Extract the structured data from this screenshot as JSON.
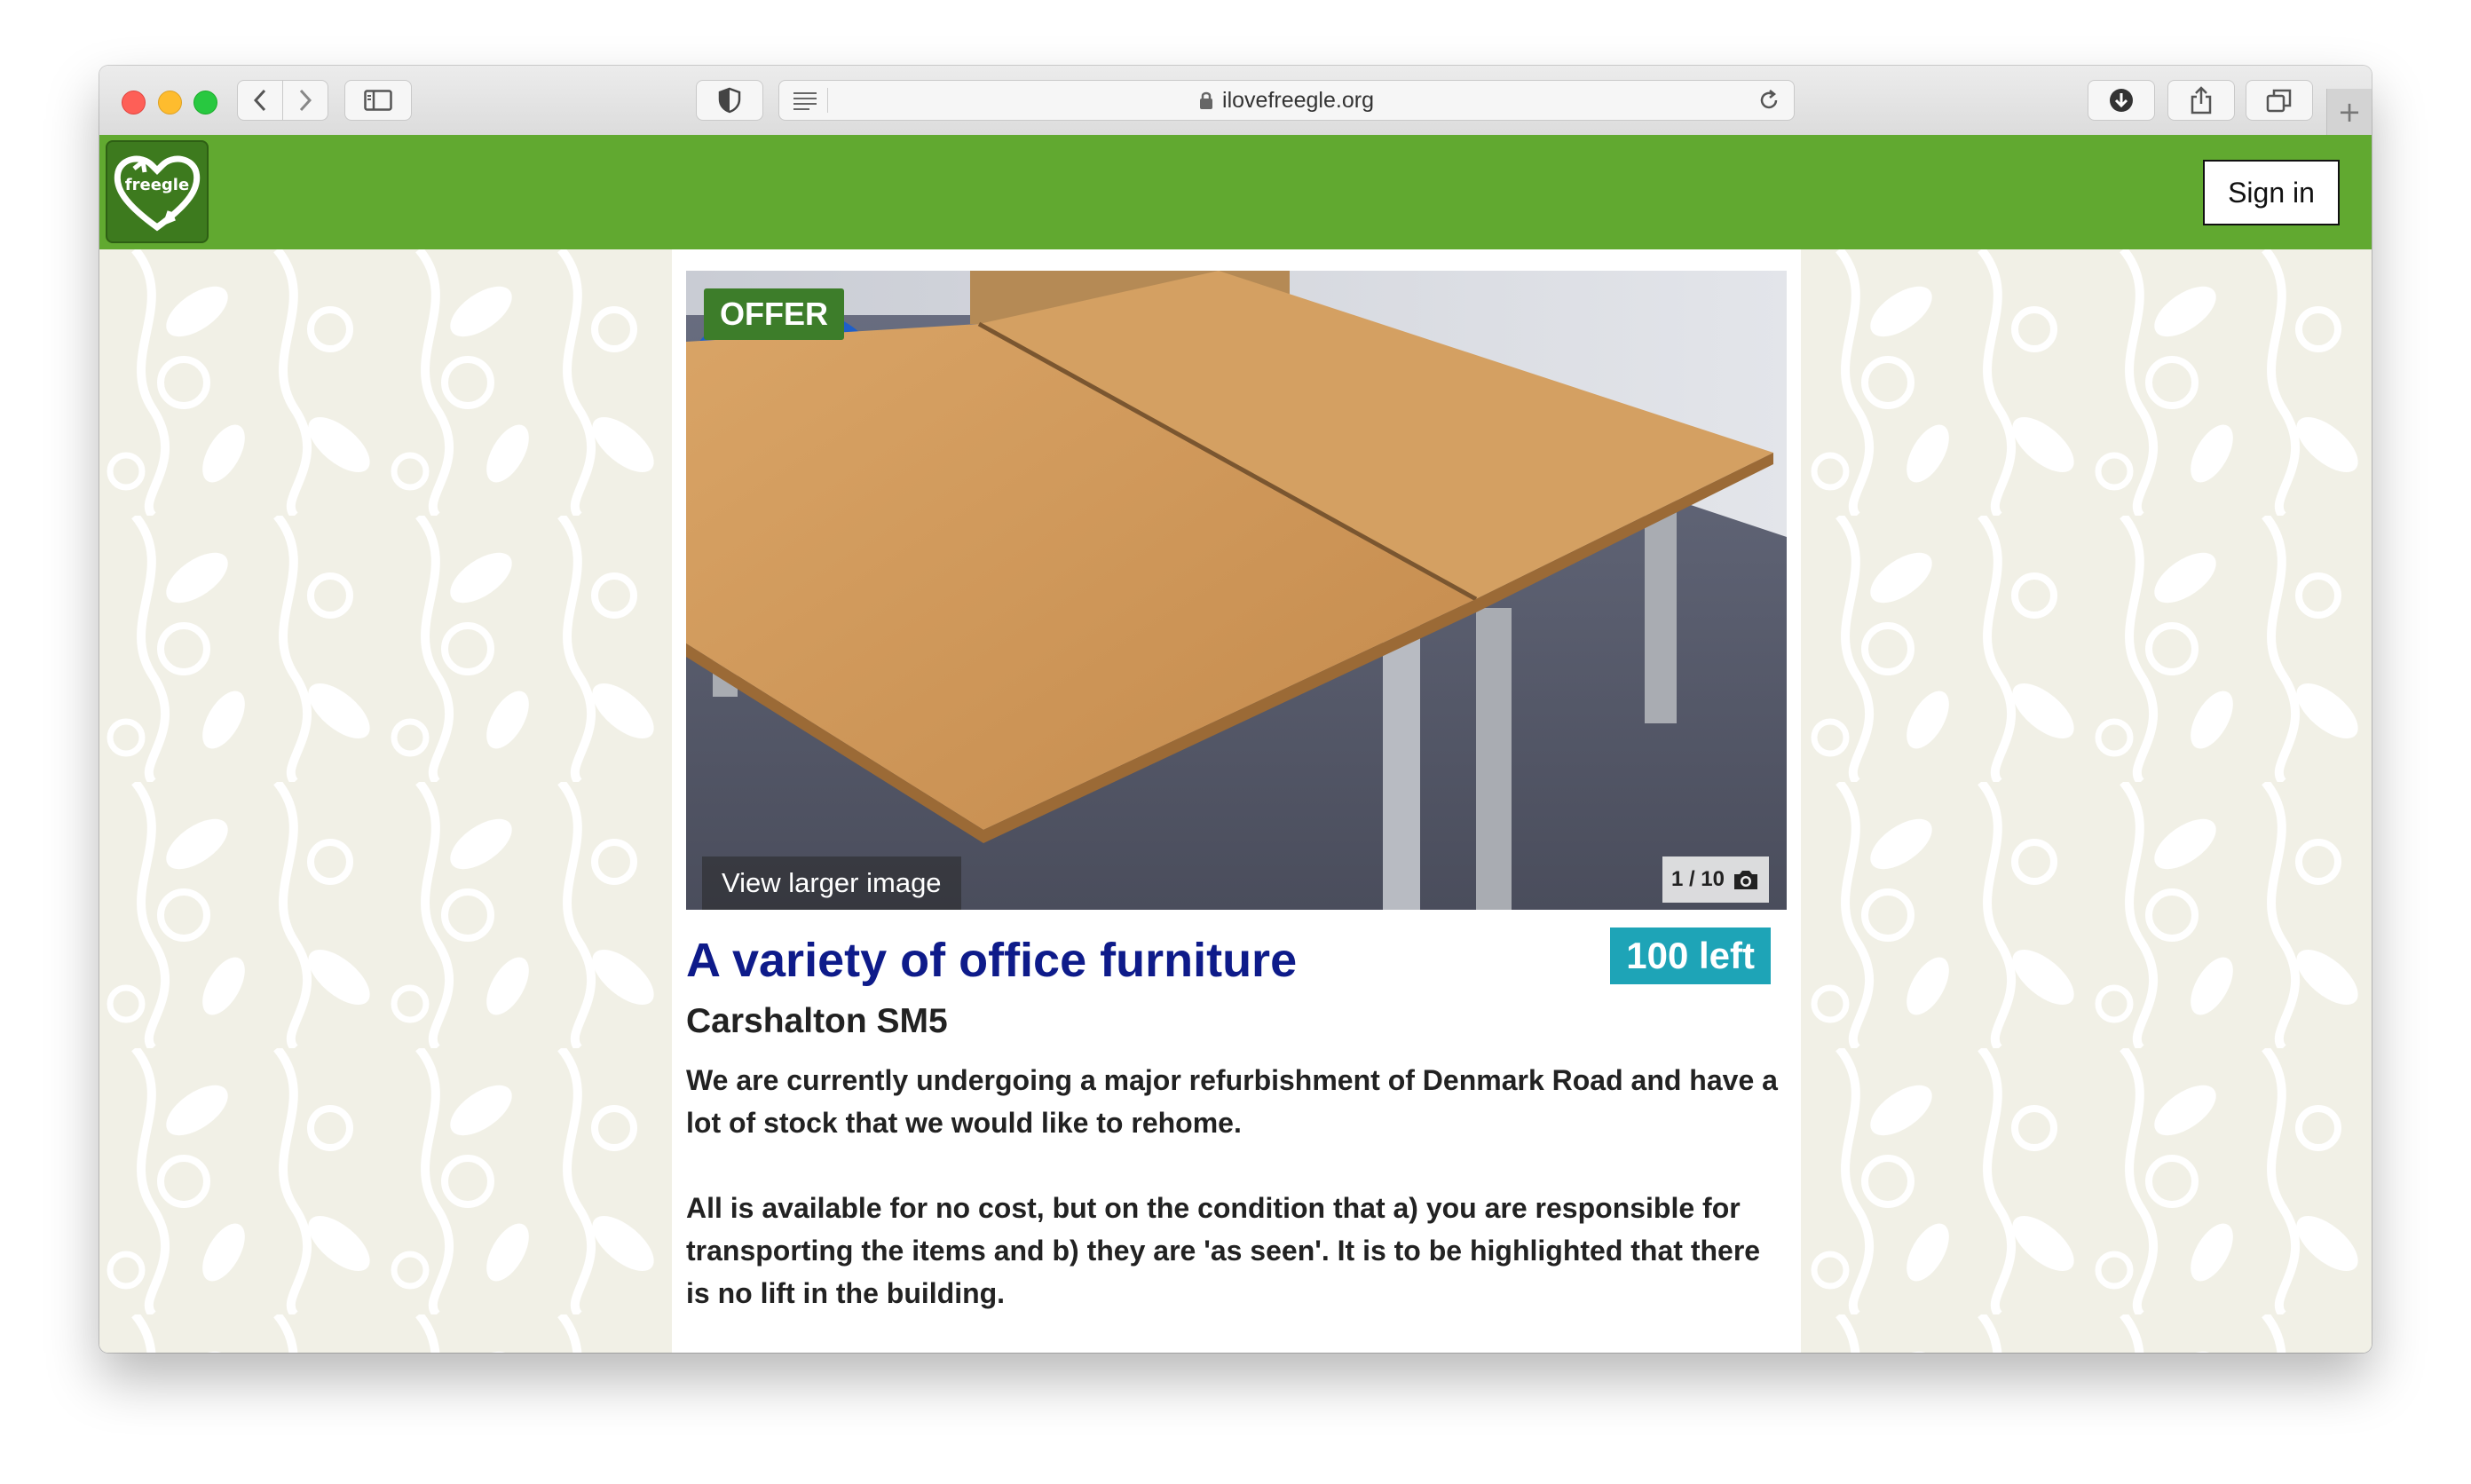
{
  "browser": {
    "url": "ilovefreegle.org",
    "icons": [
      "back-icon",
      "forward-icon",
      "sidebar-icon",
      "shield-icon",
      "reader-icon",
      "lock-icon",
      "reload-icon",
      "download-icon",
      "share-icon",
      "tabs-icon",
      "plus-icon"
    ]
  },
  "header": {
    "logo_text": "freegle",
    "signin_label": "Sign in",
    "brand_color": "#61a930"
  },
  "post": {
    "type_badge": "OFFER",
    "view_larger": "View larger image",
    "image_counter": "1 / 10",
    "title": "A variety of office furniture",
    "remaining": "100 left",
    "location": "Carshalton SM5",
    "paragraphs": [
      "We are currently undergoing a major refurbishment of Denmark Road and have a lot of stock that we would like to rehome.",
      "All is available for no cost, but on the condition that a) you are responsible for transporting the items and b) they are 'as seen'. It is to be highlighted that there is no lift in the building."
    ]
  }
}
